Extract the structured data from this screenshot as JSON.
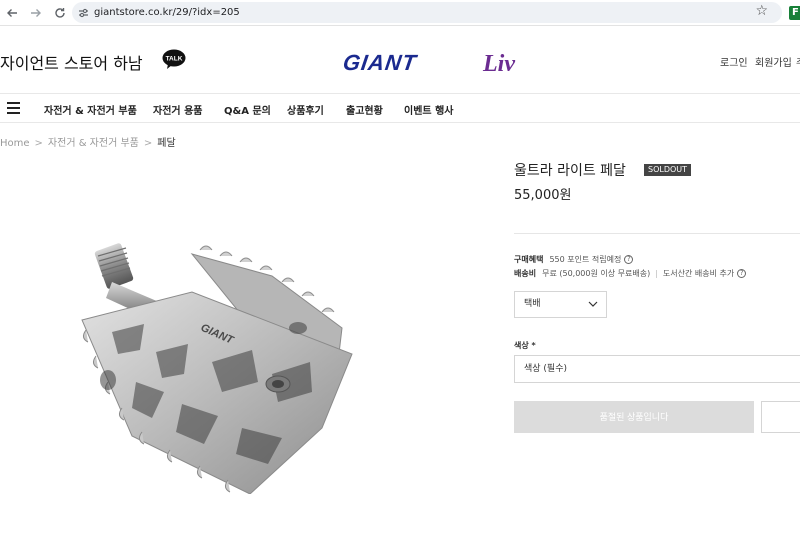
{
  "browser": {
    "url": "giantstore.co.kr/29/?idx=205"
  },
  "header": {
    "store_name": "자이언트 스토어 하남",
    "talk_badge": "TALK",
    "logo_giant": "GIANT",
    "logo_liv": "Liv",
    "login": "로그인",
    "join": "회원가입",
    "more": "주"
  },
  "nav": {
    "items": [
      {
        "label": "자전거 & 자전거 부품"
      },
      {
        "label": "자전거 용품"
      },
      {
        "label": "Q&A 문의"
      },
      {
        "label": "상품후기"
      },
      {
        "label": "출고현황"
      },
      {
        "label": "이벤트 행사"
      }
    ]
  },
  "breadcrumb": {
    "home": "Home",
    "category": "자전거 & 자전거 부품",
    "current": "페달"
  },
  "product": {
    "title": "울트라 라이트 페달",
    "badge": "SOLDOUT",
    "price": "55,000원",
    "benefit_label": "구매혜택",
    "benefit_value": "550 포인트 적립예정",
    "shipping_label": "배송비",
    "shipping_value": "무료 (50,000원 이상 무료배송)",
    "shipping_extra": "도서산간 배송비 추가",
    "shipping_method": "택배",
    "color_label": "색상 *",
    "color_placeholder": "색상 (필수)",
    "soldout_button": "품절된 상품입니다",
    "image_brand_text": "GIANT"
  },
  "colors": {
    "giant_logo": "#1b2a8f",
    "liv_logo": "#6b2c91",
    "talk_badge": "#111111"
  }
}
